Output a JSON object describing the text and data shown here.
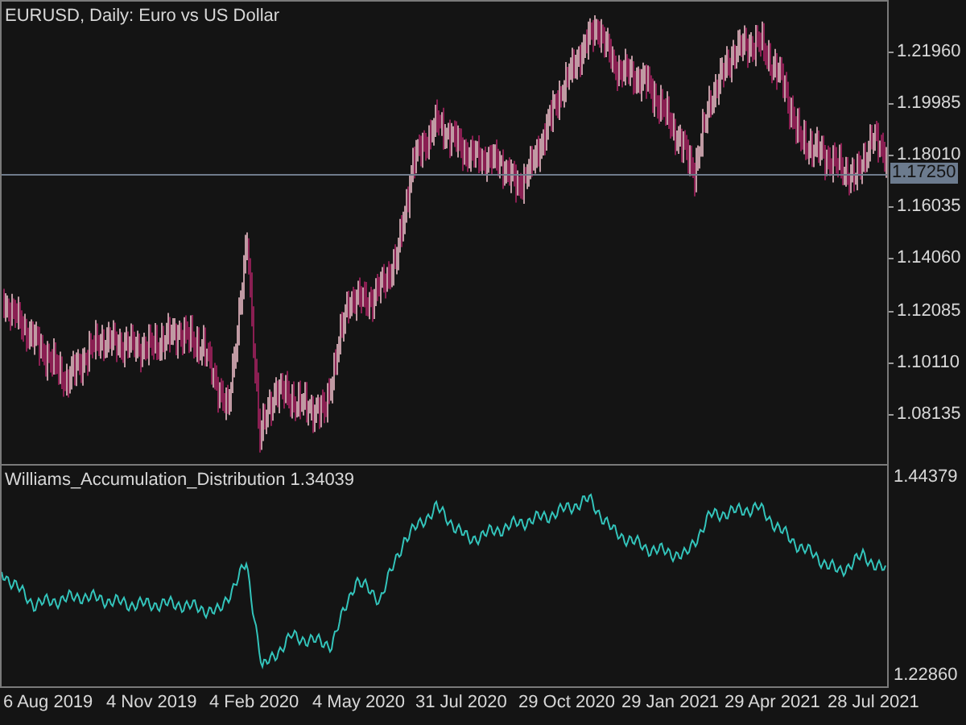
{
  "main_chart": {
    "title": "EURUSD, Daily:  Euro vs US Dollar",
    "price_axis": [
      "1.21960",
      "1.19985",
      "1.18010",
      "1.16035",
      "1.14060",
      "1.12085",
      "1.10110",
      "1.08135"
    ],
    "current_price": "1.17250"
  },
  "indicator": {
    "label": "Williams_Accumulation_Distribution 1.34039",
    "axis": [
      "1.44379",
      "1.22860"
    ]
  },
  "time_axis": [
    "6 Aug 2019",
    "4 Nov 2019",
    "4 Feb 2020",
    "4 May 2020",
    "31 Jul 2020",
    "29 Oct 2020",
    "29 Jan 2021",
    "29 Apr 2021",
    "28 Jul 2021"
  ]
}
